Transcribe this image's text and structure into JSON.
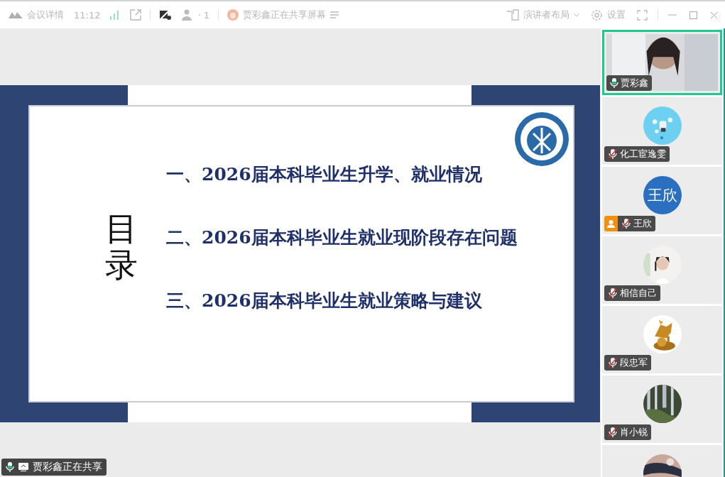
{
  "toolbar": {
    "meeting_details": "会议详情",
    "time": "11:12",
    "participant_count": "· 1",
    "sharing_status": "贾彩鑫正在共享屏幕",
    "layout": "演讲者布局",
    "settings": "设置"
  },
  "slide": {
    "heading": "目录",
    "items": [
      "一、2026届本科毕业生升学、就业情况",
      "二、2026届本科毕业生就业现阶段存在问题",
      "三、2026届本科毕业生就业策略与建议"
    ]
  },
  "participants": [
    {
      "kind": "video",
      "name": "贾彩鑫",
      "muted": false,
      "host": false,
      "selected": true
    },
    {
      "kind": "picture",
      "name": "化工宦逸雯",
      "muted": true,
      "host": false,
      "selected": false
    },
    {
      "kind": "initials",
      "avatar_text": "王欣",
      "name": "王欣",
      "muted": true,
      "host": true,
      "selected": false
    },
    {
      "kind": "picture",
      "name": "相信自己",
      "muted": true,
      "host": false,
      "selected": false
    },
    {
      "kind": "picture",
      "name": "段忠军",
      "muted": true,
      "host": false,
      "selected": false
    },
    {
      "kind": "picture",
      "name": "肖小锐",
      "muted": true,
      "host": false,
      "selected": false
    },
    {
      "kind": "picture",
      "selected": false
    }
  ],
  "share_banner": {
    "text": "贾彩鑫正在共享",
    "muted": false
  }
}
